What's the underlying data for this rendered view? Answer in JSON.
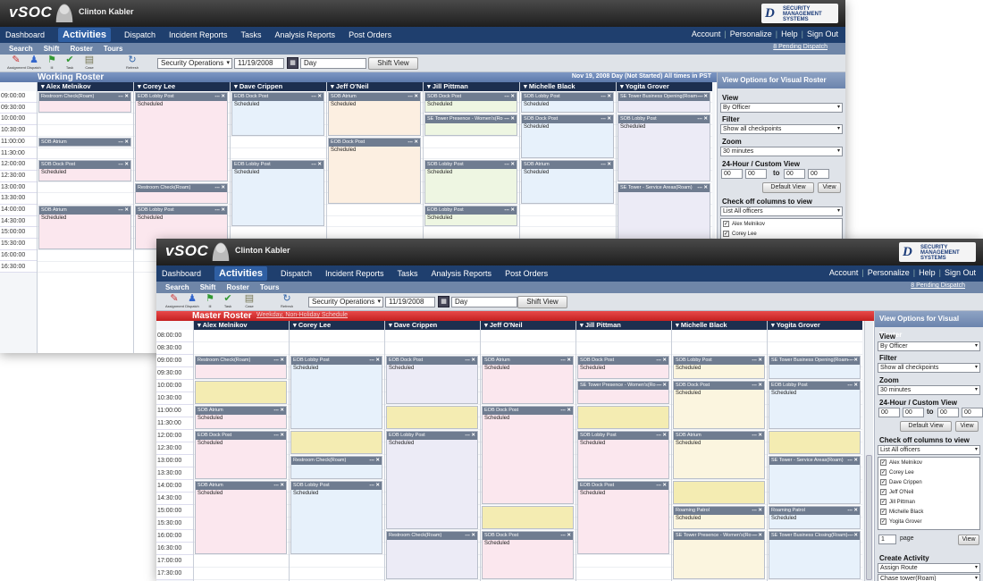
{
  "app": {
    "logo": "vSOC",
    "user": "Clinton Kabler",
    "brand_mark": "D",
    "brand_text": "SECURITY MANAGEMENT SYSTEMS"
  },
  "nav": {
    "items": [
      "Dashboard",
      "Activities",
      "Dispatch",
      "Incident Reports",
      "Tasks",
      "Analysis Reports",
      "Post Orders"
    ],
    "active": "Activities",
    "right": [
      "Account",
      "Personalize",
      "Help",
      "Sign Out"
    ],
    "sep": "|",
    "pending": "8 Pending Dispatch"
  },
  "subnav": [
    "Search",
    "Shift",
    "Roster",
    "Tours"
  ],
  "toolbar": {
    "tools": [
      {
        "label": "Assignment",
        "icon": "✎"
      },
      {
        "label": "Dispatch",
        "icon": "♟"
      },
      {
        "label": "Ill",
        "icon": "⚑"
      },
      {
        "label": "Task",
        "icon": "✔"
      },
      {
        "label": "Case",
        "icon": "▤"
      }
    ],
    "refresh": {
      "label": "Refresh",
      "icon": "↻"
    },
    "site": "Security Operations",
    "date": "11/19/2008",
    "cal_icon": "▦",
    "view": "Day",
    "shift_view": "Shift View",
    "caret": "▾"
  },
  "back": {
    "roster_title": "Working Roster",
    "roster_status": "Nov 19, 2008  Day (Not Started)  All times in  PST"
  },
  "front": {
    "roster_title": "Master Roster",
    "roster_link": "Weekday, Non-Holiday Schedule"
  },
  "officers": [
    "Alex Melnikov",
    "Corey Lee",
    "Dave Crippen",
    "Jeff O'Neil",
    "Jill Pittman",
    "Michelle Black",
    "Yogita Grover"
  ],
  "times_back": [
    "09:00:00",
    "09:30:00",
    "10:00:00",
    "10:30:00",
    "11:00:00",
    "11:30:00",
    "12:00:00",
    "12:30:00",
    "13:00:00",
    "13:30:00",
    "14:00:00",
    "14:30:00",
    "15:00:00",
    "15:30:00",
    "16:00:00",
    "16:30:00"
  ],
  "times_front": [
    "08:00:00",
    "08:30:00",
    "09:00:00",
    "09:30:00",
    "10:00:00",
    "10:30:00",
    "11:00:00",
    "11:30:00",
    "12:00:00",
    "12:30:00",
    "13:00:00",
    "13:30:00",
    "14:00:00",
    "14:30:00",
    "15:00:00",
    "15:30:00",
    "16:00:00",
    "16:30:00",
    "17:00:00",
    "17:30:00"
  ],
  "block_controls": {
    "menu": "---",
    "close": "✕"
  },
  "blocks_back": [
    {
      "col": 0,
      "start": 0,
      "dur": 2,
      "title": "Restroom Check(Roam)",
      "status": "",
      "color": "c-pink"
    },
    {
      "col": 0,
      "start": 4,
      "dur": 1,
      "title": "SOB Atrium",
      "status": "Scheduled",
      "color": "c-pink"
    },
    {
      "col": 0,
      "start": 6,
      "dur": 2,
      "title": "SOB Dock Post",
      "status": "Scheduled",
      "color": "c-pink"
    },
    {
      "col": 0,
      "start": 10,
      "dur": 4,
      "title": "SOB Atrium",
      "status": "Scheduled",
      "color": "c-pink"
    },
    {
      "col": 1,
      "start": 0,
      "dur": 8,
      "title": "EOB Lobby Post",
      "status": "Scheduled",
      "color": "c-pink"
    },
    {
      "col": 1,
      "start": 8,
      "dur": 2,
      "title": "Restroom Check(Roam)",
      "status": "",
      "color": "c-pink"
    },
    {
      "col": 1,
      "start": 10,
      "dur": 4,
      "title": "SOB Lobby Post",
      "status": "Scheduled",
      "color": "c-pink"
    },
    {
      "col": 2,
      "start": 0,
      "dur": 4,
      "title": "EOB Dock Post",
      "status": "Scheduled",
      "color": "c-blue"
    },
    {
      "col": 2,
      "start": 6,
      "dur": 6,
      "title": "EOB Lobby Post",
      "status": "Scheduled",
      "color": "c-blue"
    },
    {
      "col": 3,
      "start": 0,
      "dur": 4,
      "title": "SOB Atrium",
      "status": "Scheduled",
      "color": "c-peach"
    },
    {
      "col": 3,
      "start": 4,
      "dur": 6,
      "title": "EOB Dock Post",
      "status": "Scheduled",
      "color": "c-peach"
    },
    {
      "col": 4,
      "start": 0,
      "dur": 2,
      "title": "SOB Dock Post",
      "status": "Scheduled",
      "color": "c-green"
    },
    {
      "col": 4,
      "start": 2,
      "dur": 2,
      "title": "SE Tower Presence - Women's(Ro ---",
      "status": "",
      "color": "c-green"
    },
    {
      "col": 4,
      "start": 6,
      "dur": 4,
      "title": "SOB Lobby Post",
      "status": "Scheduled",
      "color": "c-green"
    },
    {
      "col": 4,
      "start": 10,
      "dur": 2,
      "title": "EOB Lobby Post",
      "status": "Scheduled",
      "color": "c-green"
    },
    {
      "col": 5,
      "start": 0,
      "dur": 2,
      "title": "SOB Lobby Post",
      "status": "Scheduled",
      "color": "c-blue"
    },
    {
      "col": 5,
      "start": 2,
      "dur": 4,
      "title": "SOB Dock Post",
      "status": "Scheduled",
      "color": "c-blue"
    },
    {
      "col": 5,
      "start": 6,
      "dur": 4,
      "title": "SOB Atrium",
      "status": "Scheduled",
      "color": "c-blue"
    },
    {
      "col": 6,
      "start": 0,
      "dur": 2,
      "title": "SE Tower Business Opening(Roam ---",
      "status": "",
      "color": "c-lav"
    },
    {
      "col": 6,
      "start": 2,
      "dur": 6,
      "title": "SOB Lobby Post",
      "status": "Scheduled",
      "color": "c-lav"
    },
    {
      "col": 6,
      "start": 8,
      "dur": 6,
      "title": "SE Tower - Service Areas(Roam)",
      "status": "",
      "color": "c-lav"
    }
  ],
  "blocks_front": [
    {
      "col": 0,
      "start": 2,
      "dur": 2,
      "title": "Restroom Check(Roam)",
      "status": "",
      "color": "c-pink"
    },
    {
      "col": 0,
      "start": 4,
      "dur": 2,
      "title": "",
      "status": "",
      "color": "c-gold"
    },
    {
      "col": 0,
      "start": 6,
      "dur": 2,
      "title": "SOB Atrium",
      "status": "Scheduled",
      "color": "c-pink"
    },
    {
      "col": 0,
      "start": 8,
      "dur": 4,
      "title": "EOB Dock Post",
      "status": "Scheduled",
      "color": "c-pink"
    },
    {
      "col": 0,
      "start": 12,
      "dur": 6,
      "title": "SOB Atrium",
      "status": "Scheduled",
      "color": "c-pink"
    },
    {
      "col": 1,
      "start": 2,
      "dur": 6,
      "title": "EOB Lobby Post",
      "status": "Scheduled",
      "color": "c-blue"
    },
    {
      "col": 1,
      "start": 8,
      "dur": 2,
      "title": "",
      "status": "",
      "color": "c-gold"
    },
    {
      "col": 1,
      "start": 10,
      "dur": 2,
      "title": "Restroom Check(Roam)",
      "status": "",
      "color": "c-blue"
    },
    {
      "col": 1,
      "start": 12,
      "dur": 6,
      "title": "SOB Lobby Post",
      "status": "Scheduled",
      "color": "c-blue"
    },
    {
      "col": 2,
      "start": 2,
      "dur": 4,
      "title": "EOB Dock Post",
      "status": "Scheduled",
      "color": "c-lav"
    },
    {
      "col": 2,
      "start": 6,
      "dur": 2,
      "title": "",
      "status": "",
      "color": "c-gold"
    },
    {
      "col": 2,
      "start": 8,
      "dur": 8,
      "title": "EOB Lobby Post",
      "status": "Scheduled",
      "color": "c-lav"
    },
    {
      "col": 2,
      "start": 16,
      "dur": 4,
      "title": "Restroom Check(Roam)",
      "status": "",
      "color": "c-lav"
    },
    {
      "col": 3,
      "start": 2,
      "dur": 4,
      "title": "SOB Atrium",
      "status": "Scheduled",
      "color": "c-pink"
    },
    {
      "col": 3,
      "start": 6,
      "dur": 8,
      "title": "EOB Dock Post",
      "status": "Scheduled",
      "color": "c-pink"
    },
    {
      "col": 3,
      "start": 14,
      "dur": 2,
      "title": "",
      "status": "",
      "color": "c-gold"
    },
    {
      "col": 3,
      "start": 16,
      "dur": 4,
      "title": "SOB Dock Post",
      "status": "Scheduled",
      "color": "c-pink"
    },
    {
      "col": 4,
      "start": 2,
      "dur": 2,
      "title": "SOB Dock Post",
      "status": "Scheduled",
      "color": "c-pink"
    },
    {
      "col": 4,
      "start": 4,
      "dur": 2,
      "title": "SE Tower Presence - Women's(Ro ---",
      "status": "",
      "color": "c-pink"
    },
    {
      "col": 4,
      "start": 6,
      "dur": 2,
      "title": "",
      "status": "",
      "color": "c-gold"
    },
    {
      "col": 4,
      "start": 8,
      "dur": 4,
      "title": "SOB Lobby Post",
      "status": "Scheduled",
      "color": "c-pink"
    },
    {
      "col": 4,
      "start": 12,
      "dur": 6,
      "title": "EOB Dock Post",
      "status": "Scheduled",
      "color": "c-pink"
    },
    {
      "col": 5,
      "start": 2,
      "dur": 2,
      "title": "SOB Lobby Post",
      "status": "Scheduled",
      "color": "c-yellow"
    },
    {
      "col": 5,
      "start": 4,
      "dur": 4,
      "title": "SOB Dock Post",
      "status": "Scheduled",
      "color": "c-yellow"
    },
    {
      "col": 5,
      "start": 8,
      "dur": 4,
      "title": "SOB Atrium",
      "status": "Scheduled",
      "color": "c-yellow"
    },
    {
      "col": 5,
      "start": 12,
      "dur": 2,
      "title": "",
      "status": "",
      "color": "c-gold"
    },
    {
      "col": 5,
      "start": 14,
      "dur": 2,
      "title": "Roaming Patrol",
      "status": "Scheduled",
      "color": "c-yellow"
    },
    {
      "col": 5,
      "start": 16,
      "dur": 4,
      "title": "SE Tower Presence - Women's(Ro ---",
      "status": "",
      "color": "c-yellow"
    },
    {
      "col": 6,
      "start": 2,
      "dur": 2,
      "title": "SE Tower Business Opening(Roam ---",
      "status": "",
      "color": "c-blue"
    },
    {
      "col": 6,
      "start": 4,
      "dur": 4,
      "title": "EOB Lobby Post",
      "status": "Scheduled",
      "color": "c-blue"
    },
    {
      "col": 6,
      "start": 8,
      "dur": 2,
      "title": "",
      "status": "",
      "color": "c-gold"
    },
    {
      "col": 6,
      "start": 10,
      "dur": 4,
      "title": "SE Tower - Service Areas(Roam)",
      "status": "",
      "color": "c-blue"
    },
    {
      "col": 6,
      "start": 14,
      "dur": 2,
      "title": "Roaming Patrol",
      "status": "Scheduled",
      "color": "c-blue"
    },
    {
      "col": 6,
      "start": 16,
      "dur": 4,
      "title": "SE Tower Business Closing(Roam) ---",
      "status": "",
      "color": "c-blue"
    }
  ],
  "panel": {
    "title": "View Options for Visual Roster",
    "view_label": "View",
    "view_value": "By Officer",
    "filter_label": "Filter",
    "filter_value": "Show all checkpoints",
    "zoom_label": "Zoom",
    "zoom_value": "30 minutes",
    "custom_label": "24-Hour / Custom View",
    "from_h": "00",
    "from_m": "00",
    "to_word": "to",
    "to_h": "00",
    "to_m": "00",
    "default_view": "Default View",
    "view_btn": "View",
    "columns_label": "Check off columns to view",
    "columns_filter": "List All officers",
    "officer_checks": [
      "Alex Melnikov",
      "Corey Lee",
      "Dave Crippen",
      "Jeff O'Neil",
      "Jill Pittman",
      "Michelle Black",
      "Yogita Grover"
    ],
    "checkmark": "✓",
    "page_num": "1",
    "page_word": "page",
    "page_view_btn": "View",
    "create_label": "Create Activity",
    "create_value1": "Assign Route",
    "create_value2": "Chase tower(Roam)"
  }
}
